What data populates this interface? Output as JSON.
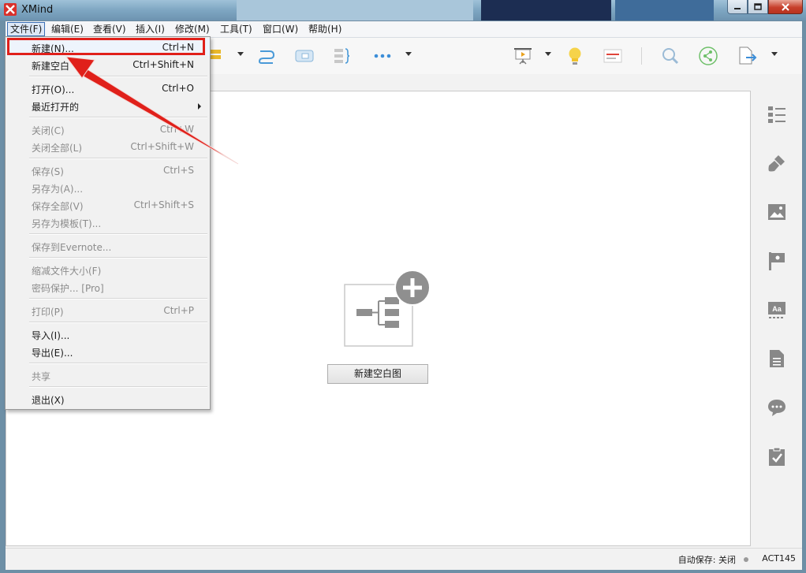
{
  "window": {
    "title": "XMind"
  },
  "menubar": {
    "items": [
      "文件(F)",
      "编辑(E)",
      "查看(V)",
      "插入(I)",
      "修改(M)",
      "工具(T)",
      "窗口(W)",
      "帮助(H)"
    ]
  },
  "file_menu": {
    "items": [
      {
        "label": "新建(N)...",
        "shortcut": "Ctrl+N",
        "enabled": true,
        "highlighted": true
      },
      {
        "label": "新建空白",
        "shortcut": "Ctrl+Shift+N",
        "enabled": true
      },
      {
        "label": "打开(O)...",
        "shortcut": "Ctrl+O",
        "enabled": true
      },
      {
        "label": "最近打开的",
        "shortcut": "",
        "enabled": true,
        "submenu": true
      },
      {
        "label": "关闭(C)",
        "shortcut": "Ctrl+W",
        "enabled": false
      },
      {
        "label": "关闭全部(L)",
        "shortcut": "Ctrl+Shift+W",
        "enabled": false
      },
      {
        "label": "保存(S)",
        "shortcut": "Ctrl+S",
        "enabled": false
      },
      {
        "label": "另存为(A)...",
        "shortcut": "",
        "enabled": false
      },
      {
        "label": "保存全部(V)",
        "shortcut": "Ctrl+Shift+S",
        "enabled": false
      },
      {
        "label": "另存为模板(T)...",
        "shortcut": "",
        "enabled": false
      },
      {
        "label": "保存到Evernote...",
        "shortcut": "",
        "enabled": false
      },
      {
        "label": "缩减文件大小(F)",
        "shortcut": "",
        "enabled": false
      },
      {
        "label": "密码保护... [Pro]",
        "shortcut": "",
        "enabled": false
      },
      {
        "label": "打印(P)",
        "shortcut": "Ctrl+P",
        "enabled": false
      },
      {
        "label": "导入(I)...",
        "shortcut": "",
        "enabled": true
      },
      {
        "label": "导出(E)...",
        "shortcut": "",
        "enabled": true
      },
      {
        "label": "共享",
        "shortcut": "",
        "enabled": false
      },
      {
        "label": "退出(X)",
        "shortcut": "",
        "enabled": true
      }
    ]
  },
  "canvas": {
    "new_blank_button": "新建空白图"
  },
  "statusbar": {
    "autosave": "自动保存: 关闭",
    "code": "ACT145"
  },
  "colors": {
    "highlight_border": "#e0201a",
    "annotation_arrow": "#e0201a",
    "brand": "#d9302b",
    "accent_blue": "#3c8ed8"
  }
}
